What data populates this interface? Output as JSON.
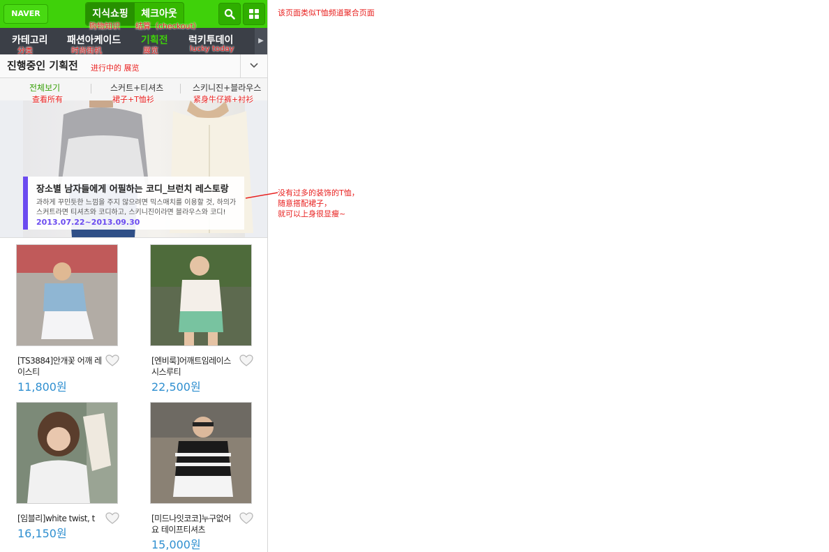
{
  "topbar": {
    "logo": "NAVER",
    "services": [
      "지식쇼핑",
      "체크아웃"
    ]
  },
  "nav": {
    "items": [
      "카테고리",
      "패션아케이드",
      "기획전",
      "럭키투데이"
    ],
    "active_index": 2
  },
  "section": {
    "title": "진행중인 기획전"
  },
  "subfilter": {
    "items": [
      "전체보기",
      "스커트+티셔츠",
      "스키니진+블라우스"
    ]
  },
  "banner": {
    "title": "장소별 남자들에게 어필하는 코디_브런치 레스토랑",
    "desc_line1": "과하게 꾸민듯한 느낌을 주지 않으려면 믹스매치를 이용할 것, 하의가",
    "desc_line2": "스커트라면 티셔츠와 코디하고, 스키니진이라면 블라우스와 코디!",
    "date": "2013.07.22~2013.09.30"
  },
  "products": [
    {
      "name": "[TS3884]안개꽃 어깨 레이스티",
      "price": "11,800원"
    },
    {
      "name": "[엔비룩]어깨트임레이스 시스루티",
      "price": "22,500원"
    },
    {
      "name": "[임블리]white twist, t",
      "price": "16,150원"
    },
    {
      "name": "[미드나잇코코]누구없어요 테이프티셔츠",
      "price": "15,000원"
    }
  ],
  "annotations": {
    "page_note": "该页面类似T恤频道聚合页面",
    "shopping_knowledge": "购物知识",
    "checkout": "结算（checkout）",
    "category": "分类",
    "fashion_arcade": "时尚街机",
    "exhibition": "展览",
    "lucky_today": "lucky today",
    "ongoing_exhibition": "进行中的 展览",
    "view_all": "查看所有",
    "skirt_tshirt": "裙子+T恤衫",
    "skinny_blouse": "紧身牛仔裤+衬衫",
    "banner_note_line1": "没有过多的装饰的T恤，",
    "banner_note_line2": "随意搭配裙子，",
    "banner_note_line3": "就可以上身很显瘦~"
  },
  "colors": {
    "brand_green": "#3fd10a",
    "nav_dark": "#3b3f47",
    "price_blue": "#2f8fd0",
    "banner_accent": "#6b4bf0",
    "annotation_red": "#e8201f"
  }
}
